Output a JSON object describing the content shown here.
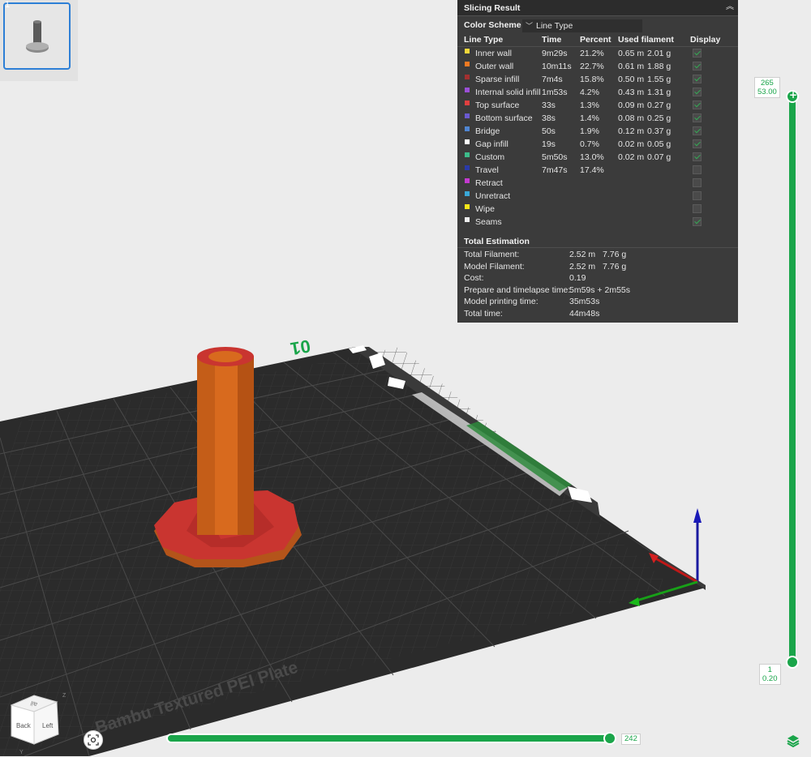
{
  "thumbnail": {
    "number": "1"
  },
  "plate": {
    "label": "Bambu Textured PEI Plate",
    "number": "01"
  },
  "panel": {
    "title": "Slicing Result",
    "color_scheme_label": "Color Scheme",
    "color_scheme_value": "Line Type",
    "columns": {
      "line_type": "Line Type",
      "time": "Time",
      "percent": "Percent",
      "used_filament": "Used filament",
      "display": "Display"
    },
    "rows": [
      {
        "name": "Inner wall",
        "color": "#f2d73a",
        "time": "9m29s",
        "percent": "21.2%",
        "meters": "0.65 m",
        "grams": "2.01 g",
        "display": true
      },
      {
        "name": "Outer wall",
        "color": "#f07a22",
        "time": "10m11s",
        "percent": "22.7%",
        "meters": "0.61 m",
        "grams": "1.88 g",
        "display": true
      },
      {
        "name": "Sparse infill",
        "color": "#a33030",
        "time": "7m4s",
        "percent": "15.8%",
        "meters": "0.50 m",
        "grams": "1.55 g",
        "display": true
      },
      {
        "name": "Internal solid infill",
        "color": "#9a4fd6",
        "time": "1m53s",
        "percent": "4.2%",
        "meters": "0.43 m",
        "grams": "1.31 g",
        "display": true
      },
      {
        "name": "Top surface",
        "color": "#e04040",
        "time": "33s",
        "percent": "1.3%",
        "meters": "0.09 m",
        "grams": "0.27 g",
        "display": true
      },
      {
        "name": "Bottom surface",
        "color": "#6a5ad0",
        "time": "38s",
        "percent": "1.4%",
        "meters": "0.08 m",
        "grams": "0.25 g",
        "display": true
      },
      {
        "name": "Bridge",
        "color": "#4f86d2",
        "time": "50s",
        "percent": "1.9%",
        "meters": "0.12 m",
        "grams": "0.37 g",
        "display": true
      },
      {
        "name": "Gap infill",
        "color": "#ffffff",
        "time": "19s",
        "percent": "0.7%",
        "meters": "0.02 m",
        "grams": "0.05 g",
        "display": true
      },
      {
        "name": "Custom",
        "color": "#3dbb8a",
        "time": "5m50s",
        "percent": "13.0%",
        "meters": "0.02 m",
        "grams": "0.07 g",
        "display": true
      },
      {
        "name": "Travel",
        "color": "#2a3aa8",
        "time": "7m47s",
        "percent": "17.4%",
        "meters": "",
        "grams": "",
        "display": false
      },
      {
        "name": "Retract",
        "color": "#c43ad0",
        "time": "",
        "percent": "",
        "meters": "",
        "grams": "",
        "display": false
      },
      {
        "name": "Unretract",
        "color": "#3aa8d8",
        "time": "",
        "percent": "",
        "meters": "",
        "grams": "",
        "display": false
      },
      {
        "name": "Wipe",
        "color": "#f5e61a",
        "time": "",
        "percent": "",
        "meters": "",
        "grams": "",
        "display": false
      },
      {
        "name": "Seams",
        "color": "#eeeeee",
        "time": "",
        "percent": "",
        "meters": "",
        "grams": "",
        "display": true
      }
    ],
    "total": {
      "title": "Total Estimation",
      "items": [
        {
          "label": "Total Filament:",
          "value": "2.52 m",
          "value2": "7.76 g"
        },
        {
          "label": "Model Filament:",
          "value": "2.52 m",
          "value2": "7.76 g"
        },
        {
          "label": "Cost:",
          "value": "0.19",
          "value2": ""
        },
        {
          "label": "Prepare and timelapse time:",
          "value": "5m59s + 2m55s",
          "value2": ""
        },
        {
          "label": "Model printing time:",
          "value": "35m53s",
          "value2": ""
        },
        {
          "label": "Total time:",
          "value": "44m48s",
          "value2": ""
        }
      ]
    }
  },
  "vertical_slider": {
    "top_layer": "265",
    "top_height": "53.00",
    "bottom_layer": "1",
    "bottom_height": "0.20"
  },
  "horizontal_slider": {
    "value": "242"
  },
  "navcube": {
    "back": "Back",
    "left": "Left",
    "axis_z": "Z",
    "axis_y": "Y",
    "top_text": "ail"
  },
  "colors": {
    "accent": "#1aa54a",
    "plate": "#2b2b2b",
    "panel_bg": "#3b3b3b",
    "model_orange": "#d86a1e",
    "model_red": "#c8302c"
  }
}
